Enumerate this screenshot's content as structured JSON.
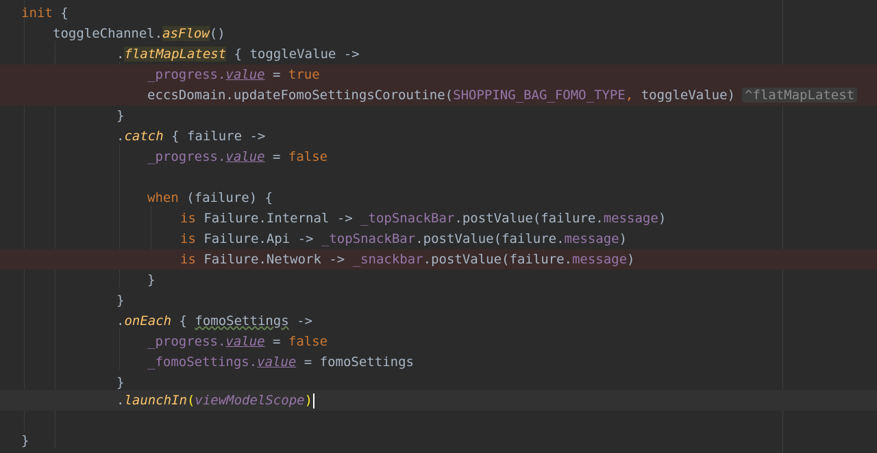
{
  "colors": {
    "background": "#2b2b2b",
    "keyword": "#cc7832",
    "function": "#ffc66d",
    "property": "#9876aa",
    "text": "#a9b7c6",
    "error_line": "#3a2a2a"
  },
  "code": {
    "l1": {
      "kw": "init",
      "rest": " {"
    },
    "l2": {
      "name": "toggleChannel.",
      "fn": "asFlow",
      "rest": "()"
    },
    "l3": {
      "dot": ".",
      "fn": "flatMapLatest",
      "rest": " { toggleValue ->"
    },
    "l4": {
      "prop": "_progress.",
      "propv": "value",
      "op": " = ",
      "kw": "true"
    },
    "l5": {
      "pre": "eccsDomain.updateFomoSettingsCoroutine(",
      "const": "SHOPPING_BAG_FOMO_TYPE",
      "comma": ",",
      "rest": " toggleValue)",
      "hint": "^flatMapLatest"
    },
    "l6": {
      "text": "}"
    },
    "l7": {
      "dot": ".",
      "fn": "catch",
      "rest": " { failure ->"
    },
    "l8": {
      "prop": "_progress.",
      "propv": "value",
      "op": " = ",
      "kw": "false"
    },
    "l10": {
      "kw": "when",
      "rest": " (failure) {"
    },
    "l11": {
      "kw": "is",
      "a": " Failure.Internal -> ",
      "prop": "_topSnackBar",
      "b": ".postValue(failure.",
      "msg": "message",
      "c": ")"
    },
    "l12": {
      "kw": "is",
      "a": " Failure.Api -> ",
      "prop": "_topSnackBar",
      "b": ".postValue(failure.",
      "msg": "message",
      "c": ")"
    },
    "l13": {
      "kw": "is",
      "a": " Failure.Network -> ",
      "prop": "_snackbar",
      "b": ".postValue(failure.",
      "msg": "message",
      "c": ")"
    },
    "l14": {
      "text": "}"
    },
    "l15": {
      "text": "}"
    },
    "l16": {
      "dot": ".",
      "fn": "onEach",
      "mid": " { ",
      "param": "fomoSettings",
      "rest": " ->"
    },
    "l17": {
      "prop": "_progress.",
      "propv": "value",
      "op": " = ",
      "kw": "false"
    },
    "l18": {
      "prop": "_fomoSettings.",
      "propv": "value",
      "rest": " = fomoSettings"
    },
    "l19": {
      "text": "}"
    },
    "l20": {
      "dot": ".",
      "fn": "launchIn",
      "open": "(",
      "arg": "viewModelScope",
      "close": ")"
    },
    "l22": {
      "text": "}"
    }
  }
}
